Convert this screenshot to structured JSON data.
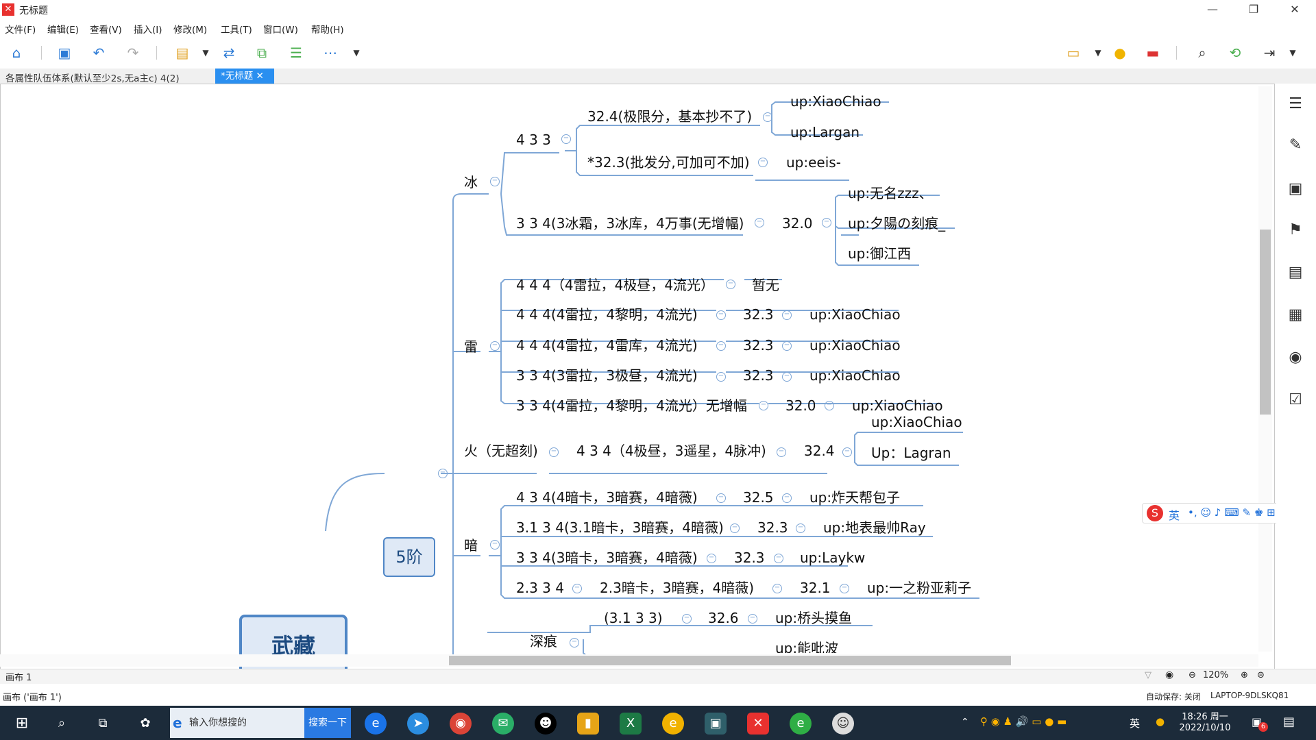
{
  "window": {
    "title": "无标题",
    "minimize": "—",
    "maximize": "❐",
    "close": "✕"
  },
  "menu": [
    "文件(F)",
    "编辑(E)",
    "查看(V)",
    "插入(I)",
    "修改(M)",
    "工具(T)",
    "窗口(W)",
    "帮助(H)"
  ],
  "tabs": {
    "first": "各属性队伍体系(默认至少2s,无a主c) 4(2)",
    "active": "*无标题",
    "active_close": "✕"
  },
  "mindmap": {
    "central": "武藏",
    "level1": "5阶",
    "ice": {
      "label": "冰",
      "b433": "4 3 3",
      "b433_a": "32.4(极限分，基本抄不了)",
      "b433_a_up1": "up:XiaoChiao",
      "b433_a_up2": "up:Largan",
      "b433_b": "*32.3(批发分,可加可不加)",
      "b433_b_up": "up:eeis-",
      "b334": "3 3 4(3冰霜，3冰库，4万事(无增幅)",
      "b334_score": "32.0",
      "b334_up1": "up:无名zzz、",
      "b334_up2": "up:夕陽の刻痕_",
      "b334_up3": "up:御江西"
    },
    "thunder": {
      "label": "雷",
      "r1": "4 4 4（4雷拉，4极昼，4流光）",
      "r1_v": "暂无",
      "r2": "4 4 4(4雷拉，4黎明，4流光)",
      "r2_s": "32.3",
      "r2_up": "up:XiaoChiao",
      "r3": "4 4 4(4雷拉，4雷库，4流光)",
      "r3_s": "32.3",
      "r3_up": "up:XiaoChiao",
      "r4": "3 3 4(3雷拉，3极昼，4流光)",
      "r4_s": "32.3",
      "r4_up": "up:XiaoChiao",
      "r5": "3 3 4(4雷拉，4黎明，4流光）无增幅",
      "r5_s": "32.0",
      "r5_up": "up:XiaoChiao"
    },
    "fire": {
      "label": "火（无超刻)",
      "f1": "4 3 4（4极昼，3遥星，4脉冲)",
      "f1_s": "32.4",
      "f1_up1": "up:XiaoChiao",
      "f1_up2": "Up：Lagran"
    },
    "dark": {
      "label": "暗",
      "d1": "4 3 4(4暗卡，3暗赛，4暗薇)",
      "d1_s": "32.5",
      "d1_up": "up:炸天帮包子",
      "d2": "3.1 3 4(3.1暗卡，3暗赛，4暗薇)",
      "d2_s": "32.3",
      "d2_up": "up:地表最帅Ray",
      "d3": "3 3 4(3暗卡，3暗赛，4暗薇)",
      "d3_s": "32.3",
      "d3_up": "up:Laykw",
      "d4": "2.3 3 4",
      "d4_b": "2.3暗卡，3暗赛，4暗薇)",
      "d4_s": "32.1",
      "d4_up": "up:一之粉亚莉子"
    },
    "deep": {
      "label": "深痕",
      "k1": "(3.1 3 3)",
      "k1_s": "32.6",
      "k1_up": "up:桥头摸鱼",
      "k2_up": "up:能吡波"
    }
  },
  "status": {
    "canvas_tab": "画布 1",
    "zoom": "120%",
    "canvas_info": "画布 ('画布 1')",
    "autosave": "自动保存: 关闭",
    "computer": "LAPTOP-9DLSKQ81"
  },
  "taskbar": {
    "search_placeholder": "输入你想搜的",
    "search_button": "搜索一下",
    "ime": "英",
    "time": "18:26 周一",
    "date": "2022/10/10",
    "notif_badge": "6"
  },
  "ime_bar": {
    "mode": "英"
  },
  "colors": {
    "accent": "#2a8ff0",
    "node_border": "#4f86c6",
    "line": "#7fa7d6",
    "taskbar": "#1c2b3a",
    "logo": "#e8312f"
  }
}
